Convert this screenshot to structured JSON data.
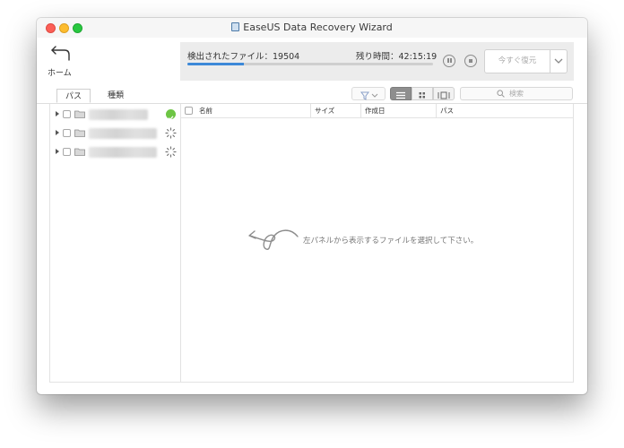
{
  "window": {
    "title": "EaseUS Data Recovery Wizard"
  },
  "header": {
    "home_label": "ホーム"
  },
  "scan": {
    "found_label": "検出されたファイル：19504",
    "remaining_label": "残り時間：42:15:19",
    "progress": 0.23,
    "recover_button": "今すぐ復元"
  },
  "tabs": [
    {
      "label": "パス"
    },
    {
      "label": "種類"
    }
  ],
  "search": {
    "placeholder": "検索"
  },
  "tree": {
    "items": [
      {
        "status": "done",
        "name_width": 66
      },
      {
        "status": "scanning",
        "name_width": 76
      },
      {
        "status": "scanning",
        "name_width": 76
      }
    ]
  },
  "file_list": {
    "columns": [
      {
        "label": "名前"
      },
      {
        "label": "サイズ"
      },
      {
        "label": "作成日"
      },
      {
        "label": "パス"
      }
    ],
    "empty_hint": "左パネルから表示するファイルを選択して下さい。"
  },
  "colors": {
    "progress": "#3d89d8",
    "ok": "#6dc544",
    "selected_view": "#8e8e8e"
  }
}
